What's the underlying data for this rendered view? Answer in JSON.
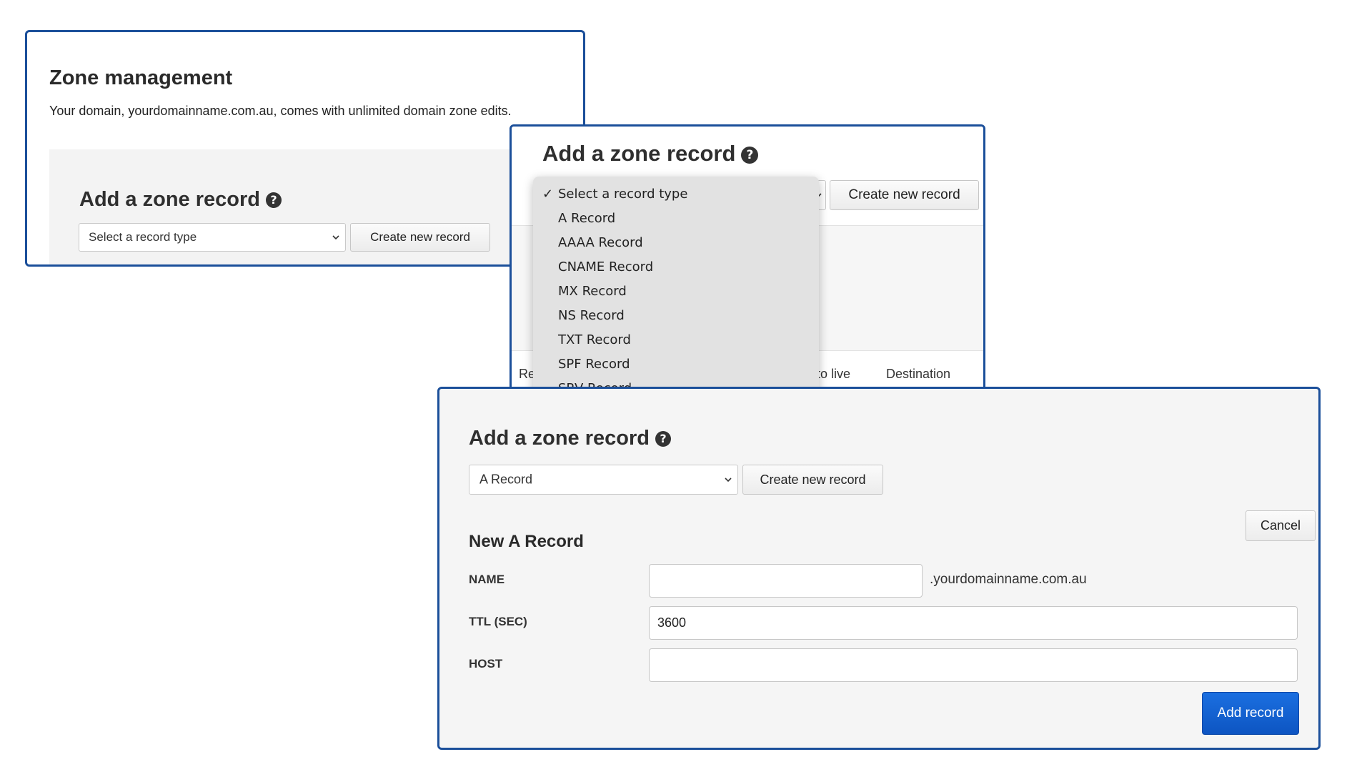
{
  "panel1": {
    "title": "Zone management",
    "description": "Your domain, yourdomainname.com.au, comes with unlimited domain zone edits.",
    "add_title": "Add a zone record",
    "help_glyph": "?",
    "select_value": "Select a record type",
    "create_button": "Create new record"
  },
  "panel2": {
    "add_title": "Add a zone record",
    "help_glyph": "?",
    "create_button": "Create new record",
    "columns": [
      "Re",
      "e to live",
      "Destination"
    ],
    "dropdown": {
      "check_glyph": "✓",
      "options": [
        {
          "label": "Select a record type",
          "selected": true
        },
        {
          "label": "A Record",
          "selected": false
        },
        {
          "label": "AAAA Record",
          "selected": false
        },
        {
          "label": "CNAME Record",
          "selected": false
        },
        {
          "label": "MX Record",
          "selected": false
        },
        {
          "label": "NS Record",
          "selected": false
        },
        {
          "label": "TXT Record",
          "selected": false
        },
        {
          "label": "SPF Record",
          "selected": false
        },
        {
          "label": "SRV Record",
          "selected": false
        }
      ]
    }
  },
  "panel3": {
    "add_title": "Add a zone record",
    "help_glyph": "?",
    "select_value": "A Record",
    "create_button": "Create new record",
    "cancel_button": "Cancel",
    "section_title": "New A Record",
    "name_label": "NAME",
    "name_value": "",
    "name_suffix": ".yourdomainname.com.au",
    "ttl_label": "TTL (SEC)",
    "ttl_value": "3600",
    "host_label": "HOST",
    "host_value": "",
    "submit_button": "Add record"
  },
  "colors": {
    "panel_border": "#1b4f9a",
    "primary_button": "#0d55c2",
    "dropdown_bg": "#e2e2e2"
  }
}
